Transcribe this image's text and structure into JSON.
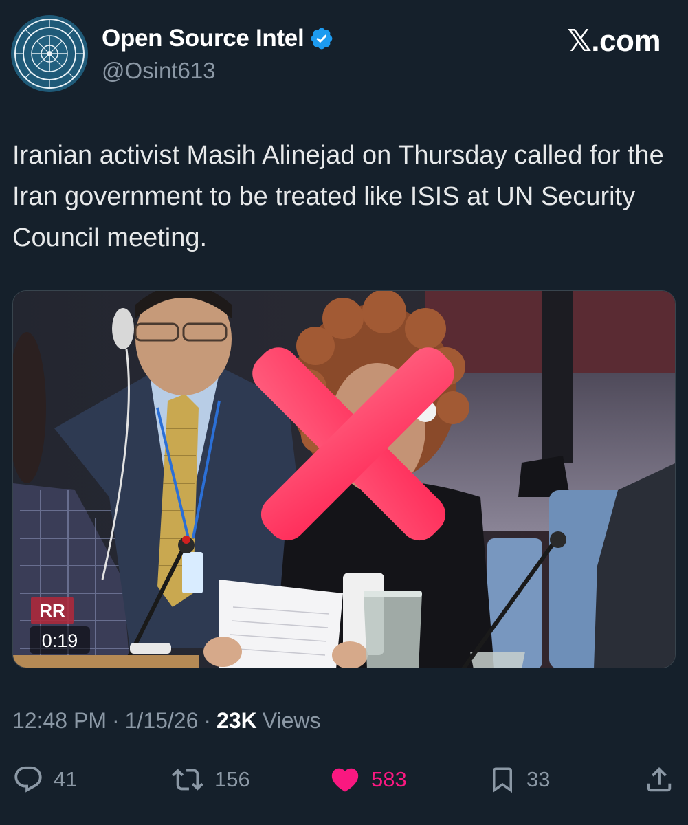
{
  "author": {
    "display_name": "Open Source Intel",
    "handle": "@Osint613",
    "avatar_icon": "osint-logo-icon",
    "verified_icon": "verified-badge-icon",
    "verified_color": "#1d9bf0"
  },
  "brand": {
    "label": "𝕏.com"
  },
  "post": {
    "text": "Iranian activist Masih Alinejad on Thursday called for the Iran government to be treated like ISIS at UN Security Council meeting."
  },
  "media": {
    "type": "video",
    "watermark": "RR",
    "duration": "0:19",
    "overlay_icon": "red-x-icon",
    "overlay_color": "#ff3b6b"
  },
  "meta": {
    "time": "12:48 PM",
    "separator": "·",
    "date": "1/15/26",
    "views_count": "23K",
    "views_label": "Views"
  },
  "actions": {
    "reply": {
      "icon": "reply-icon",
      "count": "41"
    },
    "repost": {
      "icon": "repost-icon",
      "count": "156"
    },
    "like": {
      "icon": "heart-icon",
      "count": "583",
      "active": true,
      "color": "#f91880"
    },
    "bookmark": {
      "icon": "bookmark-icon",
      "count": "33"
    },
    "share": {
      "icon": "share-icon"
    }
  },
  "colors": {
    "background": "#15202b",
    "text_primary": "#e7e9ea",
    "text_secondary": "#8b98a5",
    "border": "#38444d"
  }
}
